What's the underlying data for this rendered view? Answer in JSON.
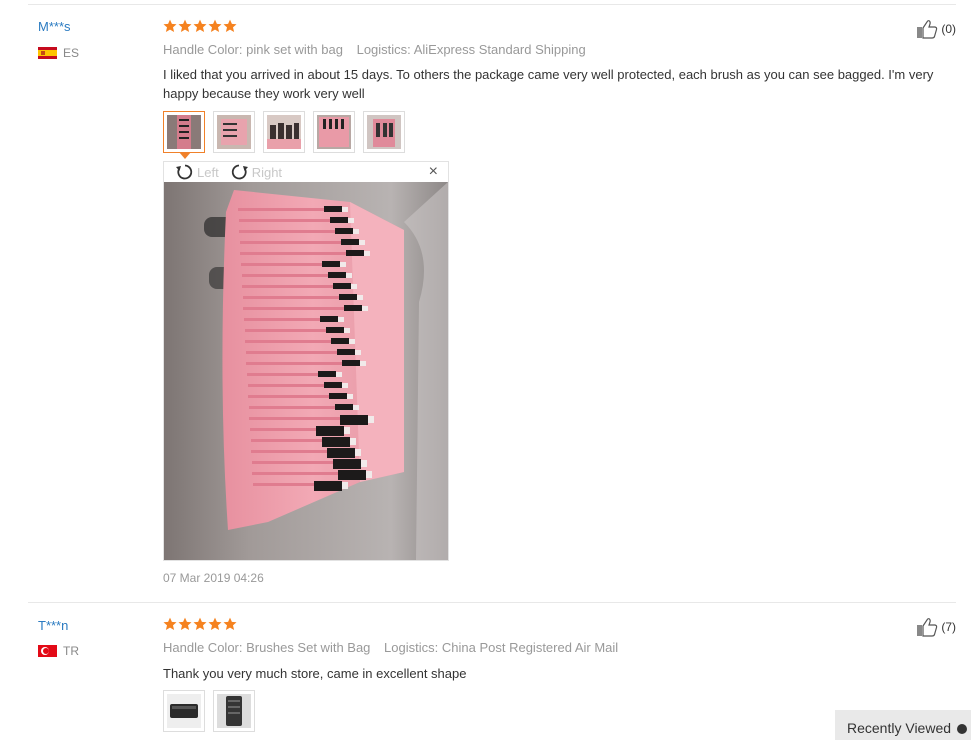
{
  "reviews": [
    {
      "user": "M***s",
      "country": "ES",
      "rating": 5,
      "handle_color_label": "Handle Color:",
      "handle_color_value": "pink set with bag",
      "logistics_label": "Logistics:",
      "logistics_value": "AliExpress Standard Shipping",
      "helpful_count": "(0)",
      "text": "I liked that you arrived in about 15 days. To others the package came very well protected, each brush as you can see bagged. I'm very happy because they work very well",
      "thumbnails": 5,
      "viewer": {
        "rotate_left": "Left",
        "rotate_right": "Right",
        "close": "×"
      },
      "date": "07 Mar 2019 04:26"
    },
    {
      "user": "T***n",
      "country": "TR",
      "rating": 5,
      "handle_color_label": "Handle Color:",
      "handle_color_value": "Brushes Set with Bag",
      "logistics_label": "Logistics:",
      "logistics_value": "China Post Registered Air Mail",
      "helpful_count": "(7)",
      "text": "Thank you very much store, came in excellent shape",
      "thumbnails": 2
    }
  ],
  "recently_viewed": "Recently Viewed",
  "colors": {
    "star": "#f5821f",
    "user_link": "#2b7bc1",
    "active_thumb": "#f0812a",
    "meta": "#999999"
  }
}
